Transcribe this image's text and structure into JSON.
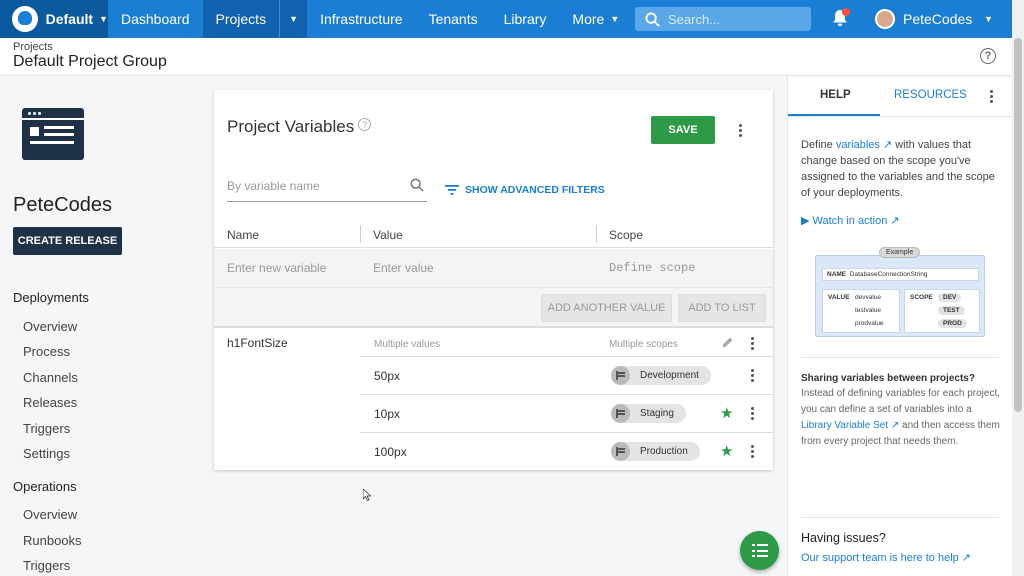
{
  "nav": {
    "space": "Default",
    "items": [
      "Dashboard",
      "Projects",
      "Infrastructure",
      "Tenants",
      "Library",
      "More"
    ],
    "search_placeholder": "Search...",
    "user": "PeteCodes"
  },
  "breadcrumb": {
    "parent": "Projects",
    "title": "Default Project Group"
  },
  "sidebar": {
    "project_name": "PeteCodes",
    "create_release": "CREATE RELEASE",
    "deployments_heading": "Deployments",
    "deployments": [
      "Overview",
      "Process",
      "Channels",
      "Releases",
      "Triggers",
      "Settings"
    ],
    "operations_heading": "Operations",
    "operations": [
      "Overview",
      "Runbooks",
      "Triggers"
    ]
  },
  "main": {
    "title": "Project Variables",
    "save": "SAVE",
    "filter_placeholder": "By variable name",
    "advanced_filters": "SHOW ADVANCED FILTERS",
    "columns": [
      "Name",
      "Value",
      "Scope"
    ],
    "new_row": {
      "name_placeholder": "Enter new variable",
      "value_placeholder": "Enter value",
      "scope_placeholder": "Define scope"
    },
    "add_another_value": "ADD ANOTHER VALUE",
    "add_to_list": "ADD TO LIST",
    "variable": {
      "name": "h1FontSize",
      "values_header": "Multiple values",
      "scopes_header": "Multiple scopes",
      "rows": [
        {
          "value": "50px",
          "scope": "Development",
          "starred": false
        },
        {
          "value": "10px",
          "scope": "Staging",
          "starred": true
        },
        {
          "value": "100px",
          "scope": "Production",
          "starred": true
        }
      ]
    }
  },
  "help": {
    "tabs": [
      "HELP",
      "RESOURCES"
    ],
    "p1_before": "Define ",
    "p1_link": "variables",
    "p1_after": " with values that change based on the scope you've assigned to the variables and the scope of your deployments.",
    "watch": "Watch in action",
    "example": {
      "label": "Example",
      "name_label": "NAME",
      "name_value": "DatabaseConnectionString",
      "value_label": "VALUE",
      "values": [
        "devvalue",
        "testvalue",
        "prodvalue"
      ],
      "scope_label": "SCOPE",
      "scopes": [
        "DEV",
        "TEST",
        "PROD"
      ]
    },
    "sharing_title": "Sharing variables between projects?",
    "sharing_before": "Instead of defining variables for each project, you can define a set of variables into a ",
    "sharing_link": "Library Variable Set",
    "sharing_after": " and then access them from every project that needs them.",
    "issues_title": "Having issues?",
    "support_link": "Our support team is here to help"
  },
  "colors": {
    "nav_blue": "#1a7ed4",
    "dark_navy": "#1f3147",
    "save_green": "#2e9a48"
  }
}
